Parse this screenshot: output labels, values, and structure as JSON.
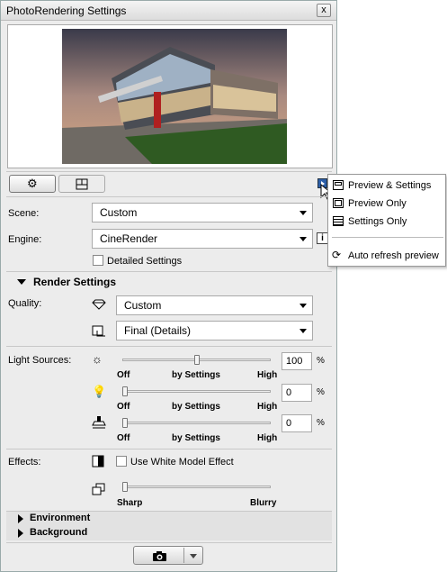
{
  "window": {
    "title": "PhotoRendering Settings",
    "close_label": "x"
  },
  "preview_menu": {
    "items": [
      {
        "label": "Preview & Settings",
        "icon": "preview-settings-icon"
      },
      {
        "label": "Preview Only",
        "icon": "preview-only-icon"
      },
      {
        "label": "Settings Only",
        "icon": "settings-only-icon"
      },
      {
        "label": "Auto refresh preview",
        "icon": "refresh-icon"
      }
    ]
  },
  "scene": {
    "label": "Scene:",
    "value": "Custom"
  },
  "engine": {
    "label": "Engine:",
    "value": "CineRender",
    "info": "i"
  },
  "detailed_settings": {
    "label": "Detailed Settings",
    "checked": false
  },
  "render_settings": {
    "header": "Render Settings",
    "quality_label": "Quality:",
    "quality_preset": "Custom",
    "quality_mode": "Final (Details)"
  },
  "light_sources": {
    "label": "Light Sources:",
    "sliders": [
      {
        "name": "sun",
        "value": "100",
        "fraction": 0.5,
        "left": "Off",
        "mid": "by Settings",
        "right": "High",
        "unit": "%"
      },
      {
        "name": "bulb",
        "value": "0",
        "fraction": 0.0,
        "left": "Off",
        "mid": "by Settings",
        "right": "High",
        "unit": "%"
      },
      {
        "name": "lamp",
        "value": "0",
        "fraction": 0.0,
        "left": "Off",
        "mid": "by Settings",
        "right": "High",
        "unit": "%"
      }
    ]
  },
  "effects": {
    "label": "Effects:",
    "white_model_label": "Use White Model Effect",
    "white_model_checked": false,
    "blur": {
      "left": "Sharp",
      "right": "Blurry",
      "fraction": 0.0
    }
  },
  "environment": {
    "header": "Environment"
  },
  "background": {
    "header": "Background"
  }
}
